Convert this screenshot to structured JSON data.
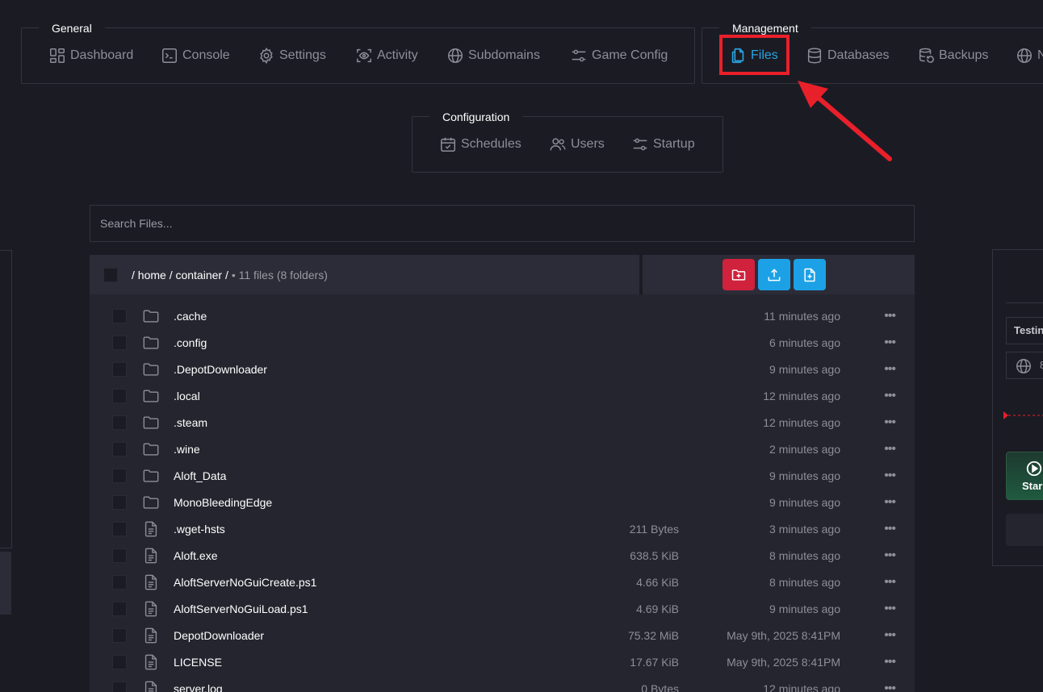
{
  "nav": {
    "general": {
      "title": "General",
      "items": [
        {
          "label": "Dashboard",
          "icon": "dashboard-icon"
        },
        {
          "label": "Console",
          "icon": "terminal-icon"
        },
        {
          "label": "Settings",
          "icon": "gear-icon"
        },
        {
          "label": "Activity",
          "icon": "eye-icon"
        },
        {
          "label": "Subdomains",
          "icon": "globe-icon"
        },
        {
          "label": "Game Config",
          "icon": "sliders-icon"
        }
      ]
    },
    "management": {
      "title": "Management",
      "items": [
        {
          "label": "Files",
          "icon": "files-icon",
          "active": true
        },
        {
          "label": "Databases",
          "icon": "database-icon"
        },
        {
          "label": "Backups",
          "icon": "backup-icon"
        },
        {
          "label": "N",
          "icon": "globe-icon"
        }
      ]
    },
    "configuration": {
      "title": "Configuration",
      "items": [
        {
          "label": "Schedules",
          "icon": "calendar-icon"
        },
        {
          "label": "Users",
          "icon": "users-icon"
        },
        {
          "label": "Startup",
          "icon": "sliders-icon"
        }
      ]
    }
  },
  "search": {
    "placeholder": "Search Files..."
  },
  "file_manager": {
    "path": "/ home / container /",
    "summary": "• 11 files (8 folders)",
    "actions": [
      {
        "name": "new-folder-button",
        "icon": "folder-plus-icon",
        "color": "#d0213d"
      },
      {
        "name": "upload-button",
        "icon": "upload-icon",
        "color": "#1da1e6"
      },
      {
        "name": "new-file-button",
        "icon": "file-plus-icon",
        "color": "#1da1e6"
      }
    ],
    "rows": [
      {
        "name": ".cache",
        "type": "folder",
        "size": "",
        "modified": "11 minutes ago"
      },
      {
        "name": ".config",
        "type": "folder",
        "size": "",
        "modified": "6 minutes ago"
      },
      {
        "name": ".DepotDownloader",
        "type": "folder",
        "size": "",
        "modified": "9 minutes ago"
      },
      {
        "name": ".local",
        "type": "folder",
        "size": "",
        "modified": "12 minutes ago"
      },
      {
        "name": ".steam",
        "type": "folder",
        "size": "",
        "modified": "12 minutes ago"
      },
      {
        "name": ".wine",
        "type": "folder",
        "size": "",
        "modified": "2 minutes ago"
      },
      {
        "name": "Aloft_Data",
        "type": "folder",
        "size": "",
        "modified": "9 minutes ago"
      },
      {
        "name": "MonoBleedingEdge",
        "type": "folder",
        "size": "",
        "modified": "9 minutes ago"
      },
      {
        "name": ".wget-hsts",
        "type": "file",
        "size": "211 Bytes",
        "modified": "3 minutes ago"
      },
      {
        "name": "Aloft.exe",
        "type": "file",
        "size": "638.5 KiB",
        "modified": "8 minutes ago"
      },
      {
        "name": "AloftServerNoGuiCreate.ps1",
        "type": "file",
        "size": "4.66 KiB",
        "modified": "8 minutes ago"
      },
      {
        "name": "AloftServerNoGuiLoad.ps1",
        "type": "file",
        "size": "4.69 KiB",
        "modified": "9 minutes ago"
      },
      {
        "name": "DepotDownloader",
        "type": "file",
        "size": "75.32 MiB",
        "modified": "May 9th, 2025 8:41PM"
      },
      {
        "name": "LICENSE",
        "type": "file",
        "size": "17.67 KiB",
        "modified": "May 9th, 2025 8:41PM"
      },
      {
        "name": "server.log",
        "type": "file",
        "size": "0 Bytes",
        "modified": "12 minutes ago"
      }
    ]
  },
  "right_panel": {
    "name_value": "Testin",
    "address_value": "8",
    "start_label": "Star"
  },
  "colors": {
    "background": "#1b1b24",
    "accent": "#29a3e0",
    "highlight": "#e8202a"
  }
}
